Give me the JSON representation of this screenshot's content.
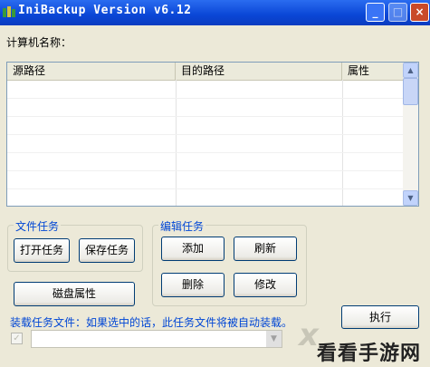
{
  "window": {
    "title": "IniBackup Version v6.12",
    "minimize_glyph": "_",
    "maximize_glyph": "□",
    "close_glyph": "×"
  },
  "computer_name_label": "计算机名称：",
  "list": {
    "columns": [
      "源路径",
      "目的路径",
      "属性"
    ],
    "rows": []
  },
  "file_task": {
    "title": "文件任务",
    "open_label": "打开任务",
    "save_label": "保存任务"
  },
  "edit_task": {
    "title": "编辑任务",
    "add_label": "添加",
    "refresh_label": "刷新",
    "delete_label": "删除",
    "modify_label": "修改"
  },
  "disk_props_label": "磁盘属性",
  "execute_label": "执行",
  "load_task": {
    "label": "装载任务文件：如果选中的话，此任务文件将被自动装载。",
    "checked": true,
    "value": ""
  },
  "watermark": {
    "text": "看看手游网"
  },
  "icons": {
    "app": "app-icon",
    "scroll_up": "chevron-up-icon",
    "scroll_down": "chevron-down-icon",
    "combo": "chevron-down-icon"
  }
}
